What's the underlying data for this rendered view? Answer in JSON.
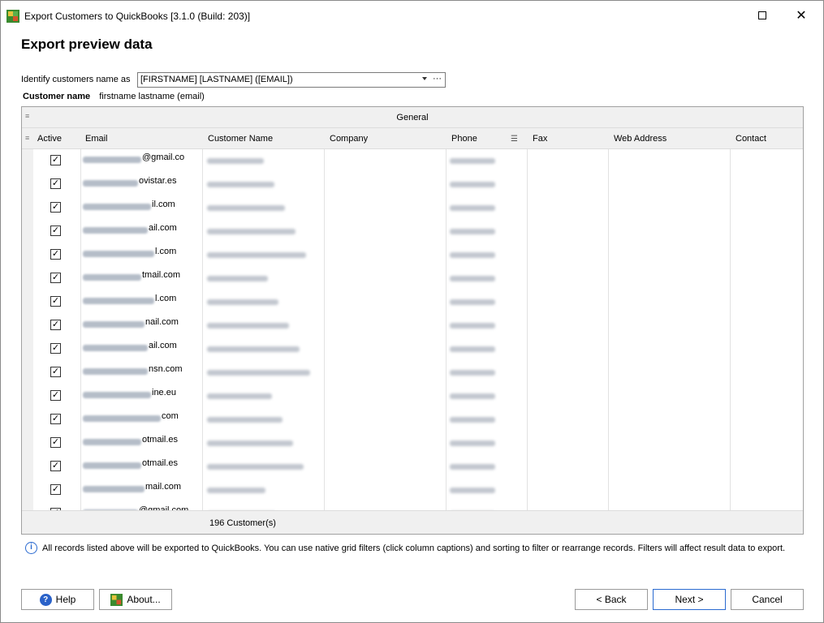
{
  "window": {
    "title": "Export Customers to QuickBooks [3.1.0 (Build: 203)]"
  },
  "page": {
    "heading": "Export preview data"
  },
  "identify": {
    "label": "Identify customers name as",
    "value": "[FIRSTNAME] [LASTNAME] ([EMAIL])",
    "ellipsis": "···"
  },
  "customer_name": {
    "label": "Customer name",
    "value": "firstname lastname (email)"
  },
  "grid": {
    "band_title": "General",
    "columns": [
      "Active",
      "Email",
      "Customer Name",
      "Company",
      "Phone",
      "Fax",
      "Web Address",
      "Contact"
    ],
    "rows": [
      {
        "email_suffix": "@gmail.co"
      },
      {
        "email_suffix": "ovistar.es"
      },
      {
        "email_suffix": "il.com"
      },
      {
        "email_suffix": "ail.com"
      },
      {
        "email_suffix": "l.com"
      },
      {
        "email_suffix": "tmail.com"
      },
      {
        "email_suffix": "l.com"
      },
      {
        "email_suffix": "nail.com"
      },
      {
        "email_suffix": "ail.com"
      },
      {
        "email_suffix": "nsn.com"
      },
      {
        "email_suffix": "ine.eu"
      },
      {
        "email_suffix": "com"
      },
      {
        "email_suffix": "otmail.es"
      },
      {
        "email_suffix": "otmail.es"
      },
      {
        "email_suffix": "mail.com"
      },
      {
        "email_suffix": "@gmail.com"
      }
    ],
    "footer_count": "196 Customer(s)"
  },
  "info": {
    "text": "All records listed above will be exported to QuickBooks. You can use native grid filters (click column captions) and sorting to filter or rearrange records. Filters will affect result data to export."
  },
  "buttons": {
    "help": "Help",
    "about": "About...",
    "back": "< Back",
    "next": "Next >",
    "cancel": "Cancel"
  },
  "colors": {
    "accent": "#2a6ad0",
    "header_bg": "#f0f0f0"
  }
}
